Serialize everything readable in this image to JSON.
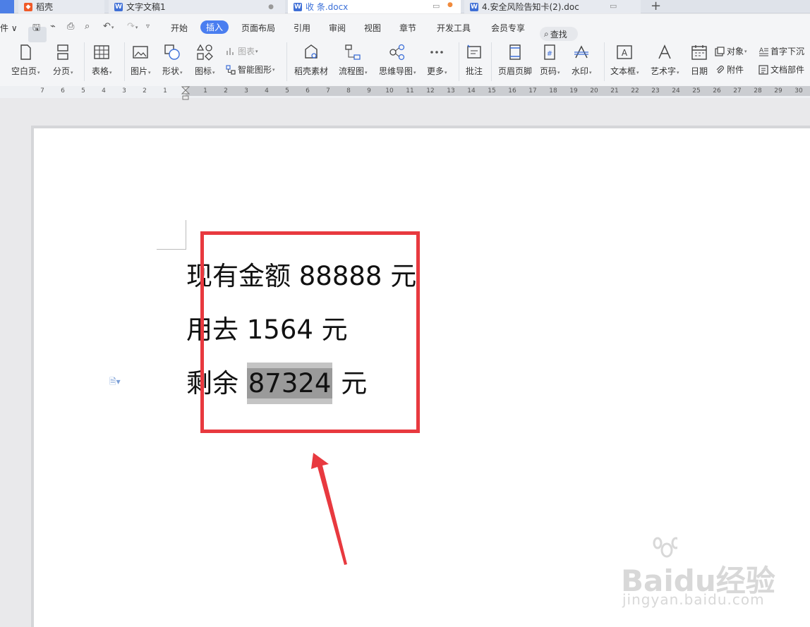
{
  "tabs": [
    {
      "label": "稻壳",
      "active": false
    },
    {
      "label": "文字文稿1",
      "active": false
    },
    {
      "label": "收 条.docx",
      "active": true
    },
    {
      "label": "4.安全风险告知卡(2).doc",
      "active": false
    }
  ],
  "menu": {
    "file_partial": "件",
    "items": [
      "开始",
      "插入",
      "页面布局",
      "引用",
      "审阅",
      "视图",
      "章节",
      "开发工具",
      "会员专享"
    ],
    "active": "插入",
    "search": "查找"
  },
  "tools": {
    "blank_page": "空白页",
    "page_break": "分页",
    "table": "表格",
    "picture": "图片",
    "shape": "形状",
    "icon": "图标",
    "chart": "图表",
    "smart_art": "智能图形",
    "daoke_material": "稻壳素材",
    "flowchart": "流程图",
    "mind_map": "思维导图",
    "more": "更多",
    "comment": "批注",
    "header_footer": "页眉页脚",
    "page_number": "页码",
    "watermark": "水印",
    "text_box": "文本框",
    "word_art": "艺术字",
    "date": "日期",
    "object": "对象",
    "attachment": "附件",
    "drop_cap": "首字下沉",
    "doc_parts": "文档部件"
  },
  "ruler": {
    "left": [
      "7",
      "6",
      "5",
      "4",
      "3",
      "2",
      "1"
    ],
    "right": [
      "1",
      "2",
      "3",
      "4",
      "5",
      "6",
      "7",
      "8",
      "9",
      "10",
      "11",
      "12",
      "13",
      "14",
      "15",
      "16",
      "17",
      "18",
      "19",
      "20",
      "21",
      "22",
      "23",
      "24",
      "25",
      "26",
      "27",
      "28",
      "29",
      "30"
    ]
  },
  "document": {
    "line1": "现有金额 88888 元",
    "line2": "用去 1564 元",
    "line3_prefix": "剩余 ",
    "line3_selected": "87324",
    "line3_suffix": " 元"
  },
  "watermark": {
    "brand": "Baidu经验",
    "url": "jingyan.baidu.com"
  },
  "colors": {
    "accent": "#4a7ef0",
    "highlight_box": "#e8393f",
    "selection": "#9a9a9a"
  }
}
